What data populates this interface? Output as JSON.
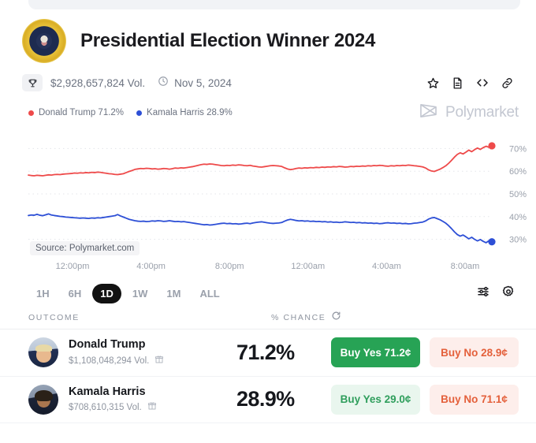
{
  "header": {
    "title": "Presidential Election Winner 2024",
    "avatar_icon": "presidential-seal-icon",
    "volume": "$2,928,657,824 Vol.",
    "date": "Nov 5, 2024",
    "trophy_icon": "trophy-icon",
    "clock_icon": "clock-icon",
    "actions": [
      {
        "name": "star-icon",
        "label": "Star"
      },
      {
        "name": "document-icon",
        "label": "Rules"
      },
      {
        "name": "embed-code-icon",
        "label": "Embed"
      },
      {
        "name": "link-icon",
        "label": "Copy link"
      }
    ]
  },
  "legend": {
    "items": [
      {
        "label": "Donald Trump 71.2%",
        "color": "#ee4a4a"
      },
      {
        "label": "Kamala Harris 28.9%",
        "color": "#2d4fd6"
      }
    ],
    "watermark": "Polymarket",
    "watermark_icon": "polymarket-logo-icon"
  },
  "chart_data": {
    "type": "line",
    "title": "Presidential Election Winner 2024",
    "source": "Source: Polymarket.com",
    "xlabel": "",
    "ylabel": "% Chance",
    "ylim": [
      25,
      75
    ],
    "yticks": [
      "30%",
      "40%",
      "50%",
      "60%",
      "70%"
    ],
    "ytick_values": [
      30,
      40,
      50,
      60,
      70
    ],
    "xticks": [
      "12:00pm",
      "4:00pm",
      "8:00pm",
      "12:00am",
      "4:00am",
      "8:00am"
    ],
    "grid": true,
    "legend_position": "top-left",
    "series": [
      {
        "name": "Donald Trump",
        "color": "#ee4a4a",
        "end_value": 71.2,
        "end_label": "70%",
        "values": [
          58.3,
          58.1,
          58.0,
          58.2,
          58.1,
          58.0,
          58.2,
          58.4,
          58.3,
          58.5,
          58.6,
          58.5,
          58.7,
          58.8,
          58.9,
          59.0,
          59.2,
          59.1,
          59.3,
          59.2,
          59.4,
          59.3,
          59.5,
          59.4,
          59.6,
          59.5,
          59.3,
          59.1,
          58.9,
          58.8,
          58.6,
          58.5,
          58.7,
          58.9,
          59.4,
          59.9,
          60.3,
          60.8,
          61.0,
          61.2,
          61.1,
          61.3,
          61.2,
          61.0,
          61.1,
          60.9,
          61.0,
          61.2,
          61.1,
          60.9,
          61.1,
          61.4,
          61.3,
          61.5,
          61.4,
          61.6,
          61.8,
          62.0,
          62.3,
          62.6,
          62.9,
          63.1,
          63.0,
          63.2,
          63.1,
          62.9,
          62.7,
          62.5,
          62.4,
          62.6,
          62.5,
          62.7,
          62.6,
          62.8,
          62.7,
          62.5,
          62.4,
          62.6,
          62.3,
          62.1,
          61.9,
          61.8,
          62.0,
          62.2,
          62.4,
          62.5,
          62.4,
          62.3,
          62.1,
          61.5,
          61.0,
          60.7,
          60.9,
          61.2,
          61.4,
          61.3,
          61.5,
          61.4,
          61.6,
          61.5,
          61.7,
          61.6,
          61.8,
          61.7,
          61.9,
          61.8,
          62.0,
          61.9,
          62.1,
          62.0,
          61.8,
          61.9,
          62.1,
          62.0,
          62.2,
          62.1,
          62.3,
          62.2,
          62.4,
          62.3,
          62.5,
          62.4,
          62.6,
          62.5,
          62.3,
          62.2,
          62.4,
          62.3,
          62.5,
          62.4,
          62.6,
          62.5,
          62.7,
          62.6,
          62.4,
          62.3,
          62.1,
          61.9,
          61.4,
          60.6,
          60.1,
          59.9,
          60.4,
          60.9,
          61.6,
          62.4,
          63.5,
          64.8,
          66.2,
          67.4,
          68.1,
          67.6,
          68.4,
          69.3,
          68.6,
          69.5,
          70.2,
          69.6,
          70.4,
          71.0,
          70.5,
          71.2
        ]
      },
      {
        "name": "Kamala Harris",
        "color": "#2d4fd6",
        "end_value": 28.9,
        "end_label": "30%",
        "values": [
          40.5,
          40.7,
          40.6,
          41.0,
          40.6,
          40.4,
          40.8,
          41.2,
          40.7,
          40.5,
          40.3,
          40.1,
          40.0,
          39.8,
          39.7,
          39.6,
          39.5,
          39.4,
          39.3,
          39.4,
          39.3,
          39.2,
          39.4,
          39.3,
          39.5,
          39.4,
          39.6,
          39.8,
          40.0,
          40.2,
          40.4,
          40.9,
          40.3,
          39.8,
          39.3,
          38.8,
          38.5,
          38.2,
          38.0,
          37.9,
          38.0,
          37.8,
          37.9,
          38.1,
          38.0,
          38.2,
          38.1,
          37.9,
          38.0,
          38.2,
          38.0,
          37.8,
          37.9,
          37.7,
          37.8,
          37.6,
          37.4,
          37.2,
          37.0,
          36.8,
          36.6,
          36.4,
          36.5,
          36.3,
          36.4,
          36.6,
          36.8,
          37.0,
          37.1,
          36.9,
          37.0,
          36.8,
          36.9,
          36.7,
          36.8,
          37.0,
          37.1,
          36.9,
          37.2,
          37.4,
          37.6,
          37.7,
          37.5,
          37.3,
          37.1,
          37.0,
          37.1,
          37.2,
          37.4,
          38.0,
          38.5,
          38.8,
          38.6,
          38.3,
          38.1,
          38.2,
          38.0,
          38.1,
          37.9,
          38.0,
          37.8,
          37.9,
          37.7,
          37.8,
          37.6,
          37.7,
          37.5,
          37.6,
          37.4,
          37.5,
          37.7,
          37.6,
          37.4,
          37.5,
          37.3,
          37.4,
          37.2,
          37.3,
          37.1,
          37.2,
          37.0,
          37.1,
          36.9,
          37.0,
          37.2,
          37.3,
          37.1,
          37.2,
          37.0,
          37.1,
          36.9,
          37.0,
          36.8,
          36.9,
          37.1,
          37.2,
          37.4,
          37.6,
          38.1,
          38.9,
          39.4,
          39.6,
          39.1,
          38.6,
          37.9,
          37.1,
          36.0,
          34.7,
          33.3,
          32.1,
          31.4,
          31.9,
          31.1,
          30.2,
          30.9,
          30.0,
          29.3,
          29.9,
          29.1,
          28.5,
          29.4,
          28.9
        ]
      }
    ]
  },
  "range_selector": {
    "options": [
      "1H",
      "6H",
      "1D",
      "1W",
      "1M",
      "ALL"
    ],
    "active": "1D",
    "tools": [
      {
        "name": "sliders-icon",
        "label": "Chart settings"
      },
      {
        "name": "gear-icon",
        "label": "Settings"
      }
    ]
  },
  "table": {
    "col_outcome": "OUTCOME",
    "col_chance": "% CHANCE",
    "refresh_icon": "refresh-icon",
    "rows": [
      {
        "avatar_icon": "donald-trump-avatar",
        "name": "Donald Trump",
        "volume": "$1,108,048,294 Vol.",
        "volume_icon": "market-icon",
        "chance": "71.2%",
        "buy_yes": "Buy Yes 71.2¢",
        "buy_no": "Buy No 28.9¢"
      },
      {
        "avatar_icon": "kamala-harris-avatar",
        "name": "Kamala Harris",
        "volume": "$708,610,315 Vol.",
        "volume_icon": "market-icon",
        "chance": "28.9%",
        "buy_yes": "Buy Yes 29.0¢",
        "buy_no": "Buy No 71.1¢"
      }
    ]
  }
}
